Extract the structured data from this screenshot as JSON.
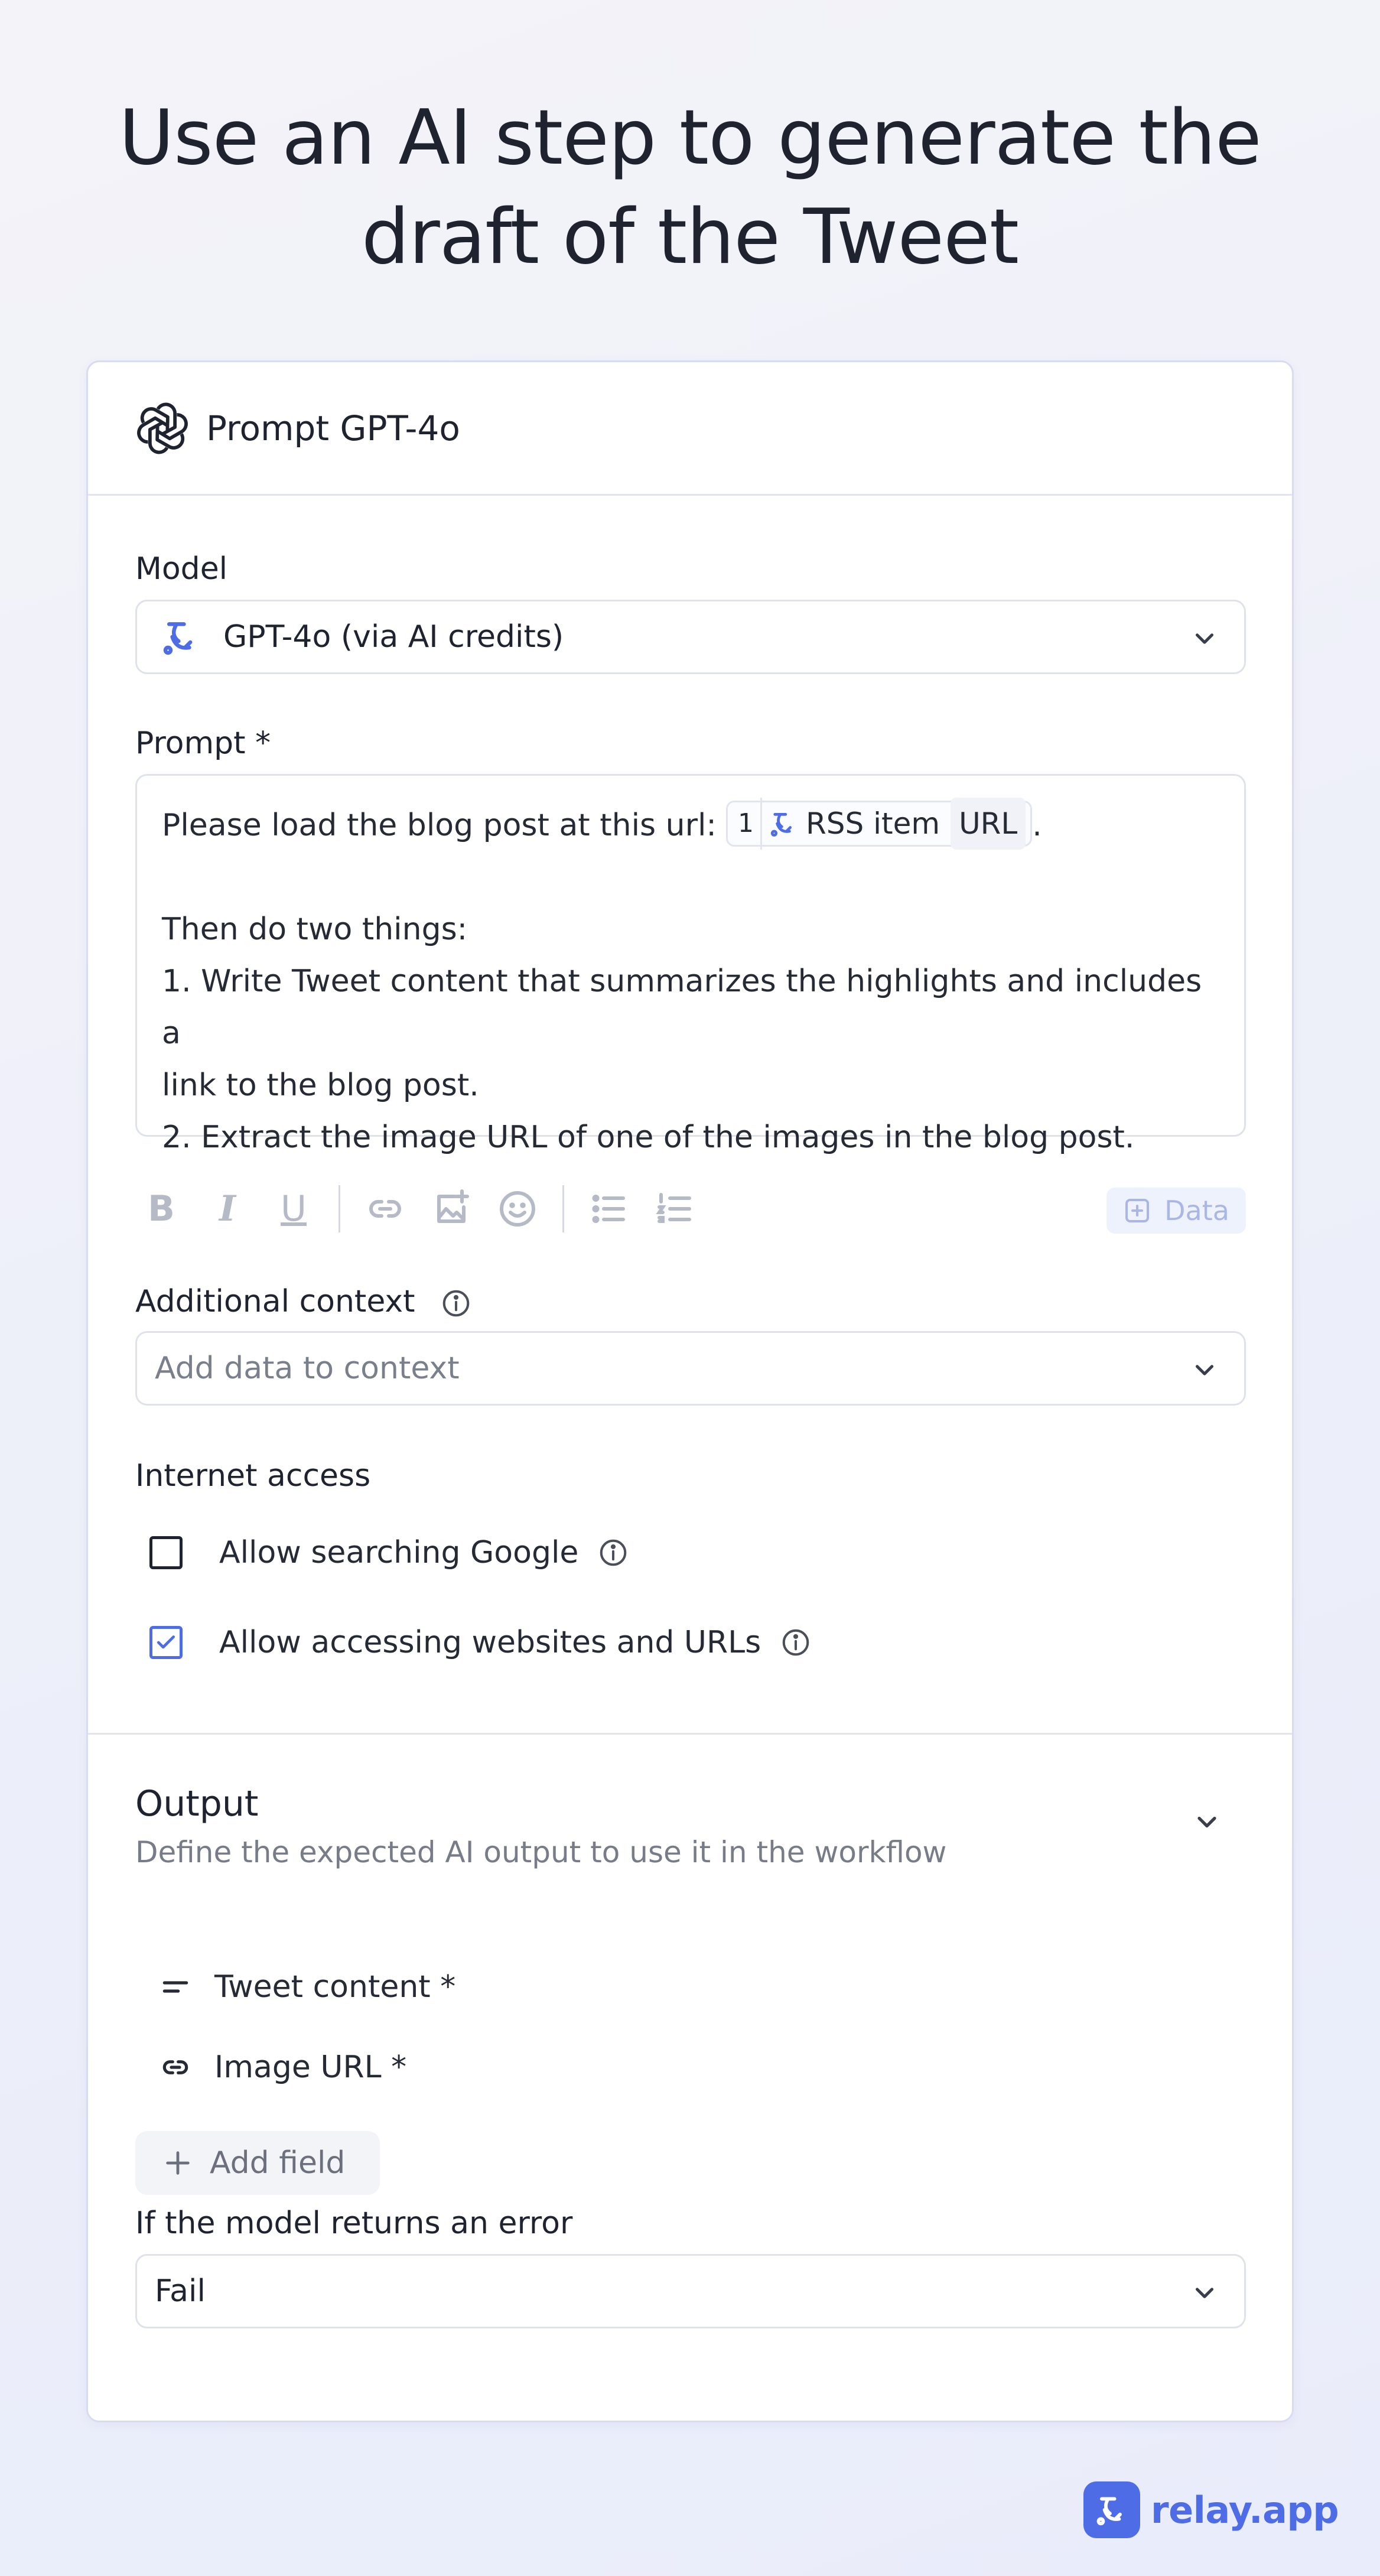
{
  "headline": {
    "line1": "Use an AI step to generate the",
    "line2": "draft of the Tweet"
  },
  "card": {
    "title": "Prompt GPT-4o",
    "model": {
      "label": "Model",
      "value": "GPT-4o (via AI credits)"
    },
    "prompt": {
      "label": "Prompt *",
      "line1_prefix": "Please load the blog post at this url:",
      "chip_step": "1",
      "chip_source": "RSS item",
      "chip_field": "URL",
      "line1_suffix": ".",
      "line3": "Then do two things:",
      "line4": "1. Write Tweet content that summarizes the highlights and includes a",
      "line5": "link to the blog post.",
      "line6": "2. Extract the image URL of one of the images in the blog post."
    },
    "toolbar": {
      "bold": "B",
      "italic": "I",
      "underline": "U",
      "data_button": "Data"
    },
    "additional_context": {
      "label": "Additional context",
      "placeholder": "Add data to context"
    },
    "internet_access": {
      "label": "Internet access",
      "options": [
        {
          "label": "Allow searching Google",
          "checked": false
        },
        {
          "label": "Allow accessing websites and URLs",
          "checked": true
        }
      ]
    },
    "output": {
      "title": "Output",
      "subtitle": "Define the expected AI output to use it in the workflow",
      "fields": [
        {
          "label": "Tweet content *",
          "icon": "text-lines-icon"
        },
        {
          "label": "Image URL *",
          "icon": "link-icon"
        }
      ],
      "add_field": "Add field"
    },
    "error": {
      "label": "If the model returns an error",
      "value": "Fail"
    }
  },
  "brand": {
    "name": "relay.app",
    "accent": "#4d6ce6"
  }
}
